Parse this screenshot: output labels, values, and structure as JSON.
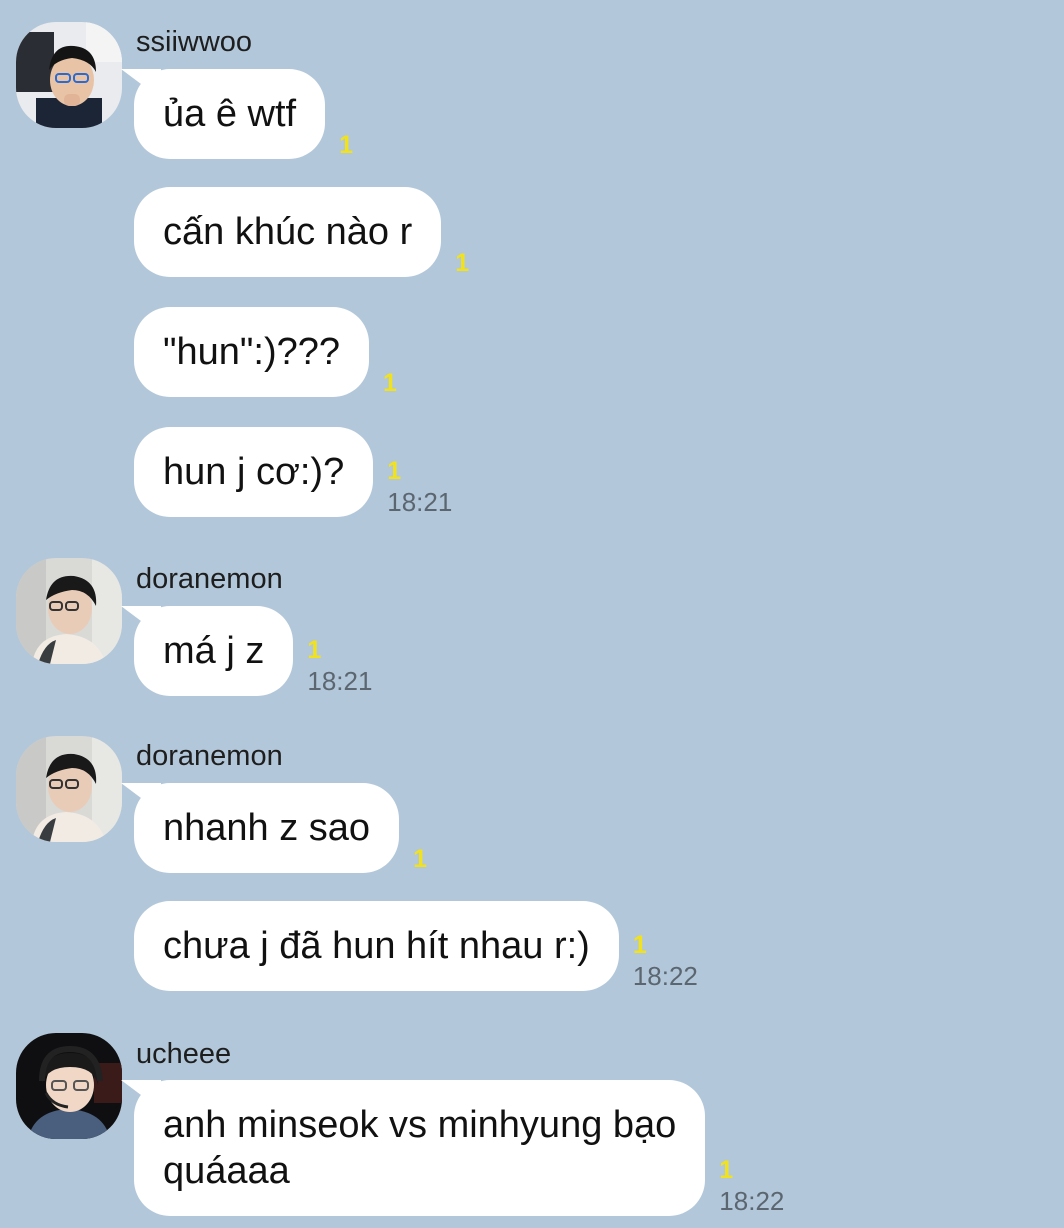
{
  "chat": {
    "background_color": "#b2c7d9",
    "unread_color": "#f2e21b",
    "groups": [
      {
        "sender": "ssiiwwoo",
        "avatar": "ssiiwwoo-avatar",
        "messages": [
          {
            "text": "ủa ê wtf",
            "unread": "1",
            "time": ""
          },
          {
            "text": "cấn khúc nào r",
            "unread": "1",
            "time": ""
          },
          {
            "text": "\"hun\":)???",
            "unread": "1",
            "time": ""
          },
          {
            "text": "hun j cơ:)?",
            "unread": "1",
            "time": "18:21"
          }
        ]
      },
      {
        "sender": "doranemon",
        "avatar": "doranemon-avatar",
        "messages": [
          {
            "text": "má j z",
            "unread": "1",
            "time": "18:21"
          }
        ]
      },
      {
        "sender": "doranemon",
        "avatar": "doranemon-avatar",
        "messages": [
          {
            "text": "nhanh z sao",
            "unread": "1",
            "time": ""
          },
          {
            "text": "chưa j đã hun hít nhau r:)",
            "unread": "1",
            "time": "18:22"
          }
        ]
      },
      {
        "sender": "ucheee",
        "avatar": "ucheee-avatar",
        "messages": [
          {
            "text": "anh minseok vs minhyung bạo",
            "text_line2": "quáaaa",
            "unread": "1",
            "time": "18:22"
          }
        ]
      }
    ]
  }
}
